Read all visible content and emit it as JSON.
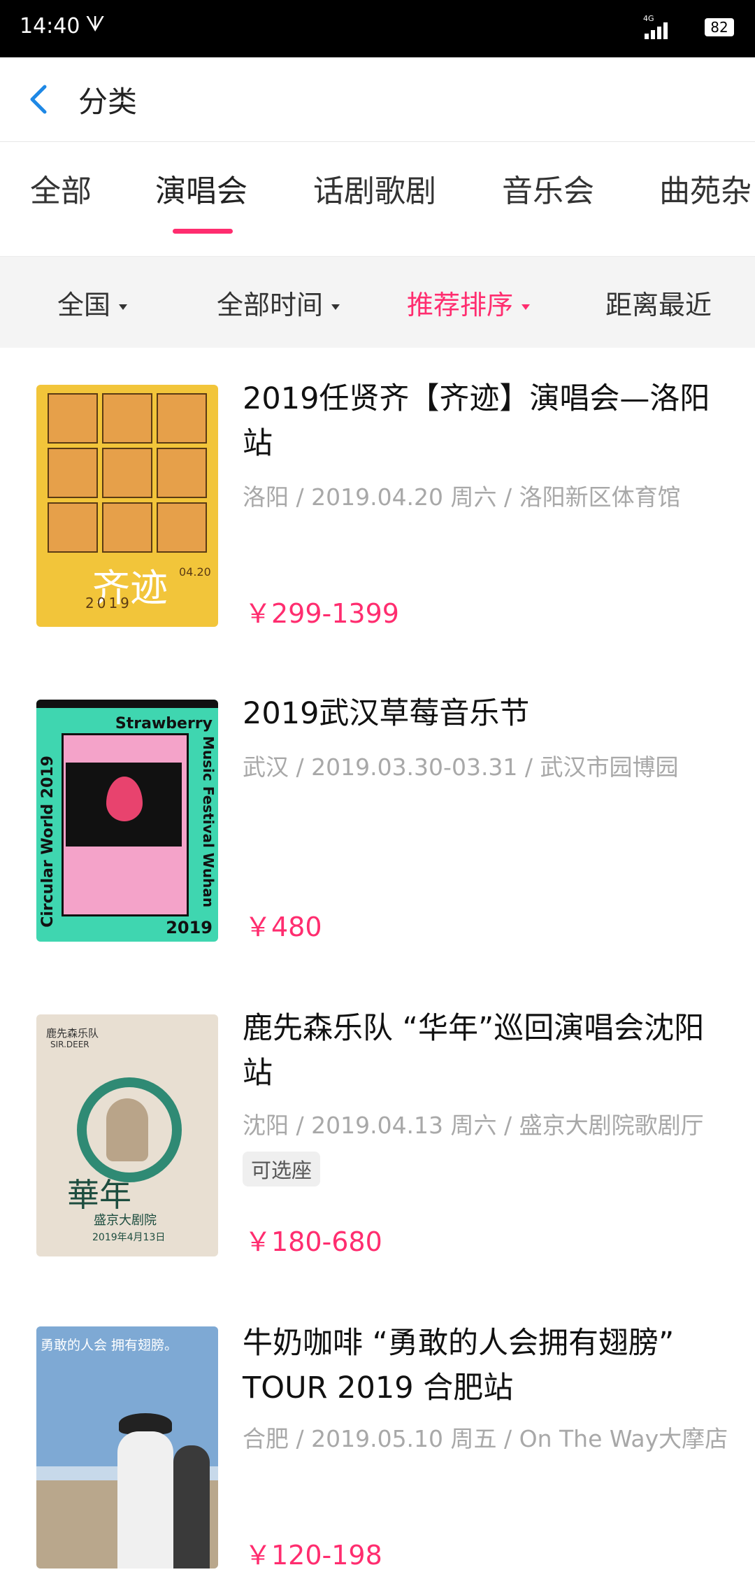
{
  "status_bar": {
    "time": "14:40",
    "carrier_glyph": "ᗐ",
    "network": "4G",
    "battery": "82"
  },
  "header": {
    "title": "分类"
  },
  "category_tabs": [
    {
      "label": "全部",
      "active": false
    },
    {
      "label": "演唱会",
      "active": true
    },
    {
      "label": "话剧歌剧",
      "active": false
    },
    {
      "label": "音乐会",
      "active": false
    },
    {
      "label": "曲苑杂",
      "active": false
    }
  ],
  "filters": [
    {
      "label": "全国",
      "active": false,
      "dropdown": true
    },
    {
      "label": "全部时间",
      "active": false,
      "dropdown": true
    },
    {
      "label": "推荐排序",
      "active": true,
      "dropdown": true
    },
    {
      "label": "距离最近",
      "active": false,
      "dropdown": false
    }
  ],
  "events": [
    {
      "title": "2019任贤齐【齐迹】演唱会—洛阳站",
      "meta": "洛阳 / 2019.04.20 周六 / 洛阳新区体育馆",
      "tag": "",
      "price": "￥299-1399",
      "poster": {
        "big": "齐迹",
        "yr": "2019",
        "dt": "04.20"
      }
    },
    {
      "title": "2019武汉草莓音乐节",
      "meta": "武汉 / 2019.03.30-03.31 / 武汉市园博园",
      "tag": "",
      "price": "￥480",
      "poster": {
        "hd": "Strawberry",
        "side": "Circular World 2019",
        "side2": "Music Festival Wuhan",
        "yr": "2019"
      }
    },
    {
      "title": "鹿先森乐队 “华年”巡回演唱会沈阳站",
      "meta": "沈阳 / 2019.04.13 周六 / 盛京大剧院歌剧厅",
      "tag": "可选座",
      "price": "￥180-680",
      "poster": {
        "lbl1": "鹿先森乐队",
        "lbl2": "SIR.DEER",
        "cal": "華年",
        "v1": "盛京大剧院",
        "v2": "2019年4月13日"
      }
    },
    {
      "title": "牛奶咖啡 “勇敢的人会拥有翅膀” TOUR 2019 合肥站",
      "meta": "合肥 / 2019.05.10 周五 / On The Way大摩店",
      "tag": "",
      "price": "￥120-198",
      "poster": {
        "t1": "勇敢的人会 拥有翅膀。"
      }
    }
  ],
  "colors": {
    "accent": "#ff2d6f",
    "filter_bg": "#f4f4f4",
    "meta_text": "#a8a8a8"
  }
}
